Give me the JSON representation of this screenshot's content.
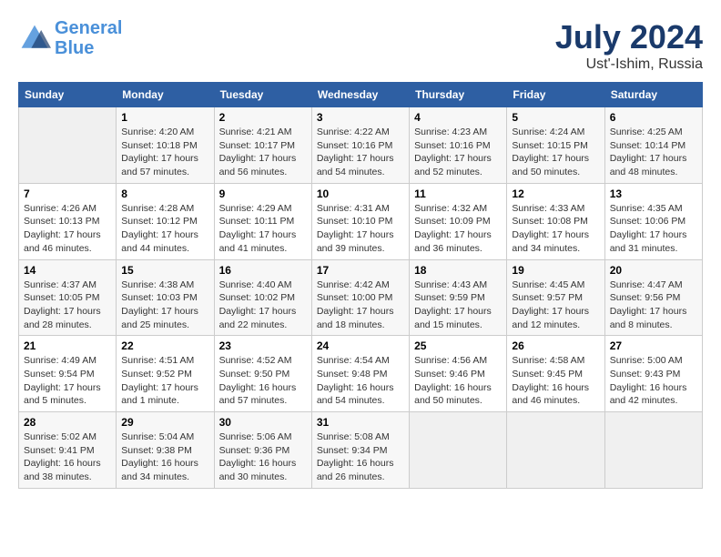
{
  "header": {
    "logo_line1": "General",
    "logo_line2": "Blue",
    "month_year": "July 2024",
    "location": "Ust'-Ishim, Russia"
  },
  "weekdays": [
    "Sunday",
    "Monday",
    "Tuesday",
    "Wednesday",
    "Thursday",
    "Friday",
    "Saturday"
  ],
  "weeks": [
    [
      {
        "day": "",
        "info": ""
      },
      {
        "day": "1",
        "info": "Sunrise: 4:20 AM\nSunset: 10:18 PM\nDaylight: 17 hours\nand 57 minutes."
      },
      {
        "day": "2",
        "info": "Sunrise: 4:21 AM\nSunset: 10:17 PM\nDaylight: 17 hours\nand 56 minutes."
      },
      {
        "day": "3",
        "info": "Sunrise: 4:22 AM\nSunset: 10:16 PM\nDaylight: 17 hours\nand 54 minutes."
      },
      {
        "day": "4",
        "info": "Sunrise: 4:23 AM\nSunset: 10:16 PM\nDaylight: 17 hours\nand 52 minutes."
      },
      {
        "day": "5",
        "info": "Sunrise: 4:24 AM\nSunset: 10:15 PM\nDaylight: 17 hours\nand 50 minutes."
      },
      {
        "day": "6",
        "info": "Sunrise: 4:25 AM\nSunset: 10:14 PM\nDaylight: 17 hours\nand 48 minutes."
      }
    ],
    [
      {
        "day": "7",
        "info": "Sunrise: 4:26 AM\nSunset: 10:13 PM\nDaylight: 17 hours\nand 46 minutes."
      },
      {
        "day": "8",
        "info": "Sunrise: 4:28 AM\nSunset: 10:12 PM\nDaylight: 17 hours\nand 44 minutes."
      },
      {
        "day": "9",
        "info": "Sunrise: 4:29 AM\nSunset: 10:11 PM\nDaylight: 17 hours\nand 41 minutes."
      },
      {
        "day": "10",
        "info": "Sunrise: 4:31 AM\nSunset: 10:10 PM\nDaylight: 17 hours\nand 39 minutes."
      },
      {
        "day": "11",
        "info": "Sunrise: 4:32 AM\nSunset: 10:09 PM\nDaylight: 17 hours\nand 36 minutes."
      },
      {
        "day": "12",
        "info": "Sunrise: 4:33 AM\nSunset: 10:08 PM\nDaylight: 17 hours\nand 34 minutes."
      },
      {
        "day": "13",
        "info": "Sunrise: 4:35 AM\nSunset: 10:06 PM\nDaylight: 17 hours\nand 31 minutes."
      }
    ],
    [
      {
        "day": "14",
        "info": "Sunrise: 4:37 AM\nSunset: 10:05 PM\nDaylight: 17 hours\nand 28 minutes."
      },
      {
        "day": "15",
        "info": "Sunrise: 4:38 AM\nSunset: 10:03 PM\nDaylight: 17 hours\nand 25 minutes."
      },
      {
        "day": "16",
        "info": "Sunrise: 4:40 AM\nSunset: 10:02 PM\nDaylight: 17 hours\nand 22 minutes."
      },
      {
        "day": "17",
        "info": "Sunrise: 4:42 AM\nSunset: 10:00 PM\nDaylight: 17 hours\nand 18 minutes."
      },
      {
        "day": "18",
        "info": "Sunrise: 4:43 AM\nSunset: 9:59 PM\nDaylight: 17 hours\nand 15 minutes."
      },
      {
        "day": "19",
        "info": "Sunrise: 4:45 AM\nSunset: 9:57 PM\nDaylight: 17 hours\nand 12 minutes."
      },
      {
        "day": "20",
        "info": "Sunrise: 4:47 AM\nSunset: 9:56 PM\nDaylight: 17 hours\nand 8 minutes."
      }
    ],
    [
      {
        "day": "21",
        "info": "Sunrise: 4:49 AM\nSunset: 9:54 PM\nDaylight: 17 hours\nand 5 minutes."
      },
      {
        "day": "22",
        "info": "Sunrise: 4:51 AM\nSunset: 9:52 PM\nDaylight: 17 hours\nand 1 minute."
      },
      {
        "day": "23",
        "info": "Sunrise: 4:52 AM\nSunset: 9:50 PM\nDaylight: 16 hours\nand 57 minutes."
      },
      {
        "day": "24",
        "info": "Sunrise: 4:54 AM\nSunset: 9:48 PM\nDaylight: 16 hours\nand 54 minutes."
      },
      {
        "day": "25",
        "info": "Sunrise: 4:56 AM\nSunset: 9:46 PM\nDaylight: 16 hours\nand 50 minutes."
      },
      {
        "day": "26",
        "info": "Sunrise: 4:58 AM\nSunset: 9:45 PM\nDaylight: 16 hours\nand 46 minutes."
      },
      {
        "day": "27",
        "info": "Sunrise: 5:00 AM\nSunset: 9:43 PM\nDaylight: 16 hours\nand 42 minutes."
      }
    ],
    [
      {
        "day": "28",
        "info": "Sunrise: 5:02 AM\nSunset: 9:41 PM\nDaylight: 16 hours\nand 38 minutes."
      },
      {
        "day": "29",
        "info": "Sunrise: 5:04 AM\nSunset: 9:38 PM\nDaylight: 16 hours\nand 34 minutes."
      },
      {
        "day": "30",
        "info": "Sunrise: 5:06 AM\nSunset: 9:36 PM\nDaylight: 16 hours\nand 30 minutes."
      },
      {
        "day": "31",
        "info": "Sunrise: 5:08 AM\nSunset: 9:34 PM\nDaylight: 16 hours\nand 26 minutes."
      },
      {
        "day": "",
        "info": ""
      },
      {
        "day": "",
        "info": ""
      },
      {
        "day": "",
        "info": ""
      }
    ]
  ]
}
